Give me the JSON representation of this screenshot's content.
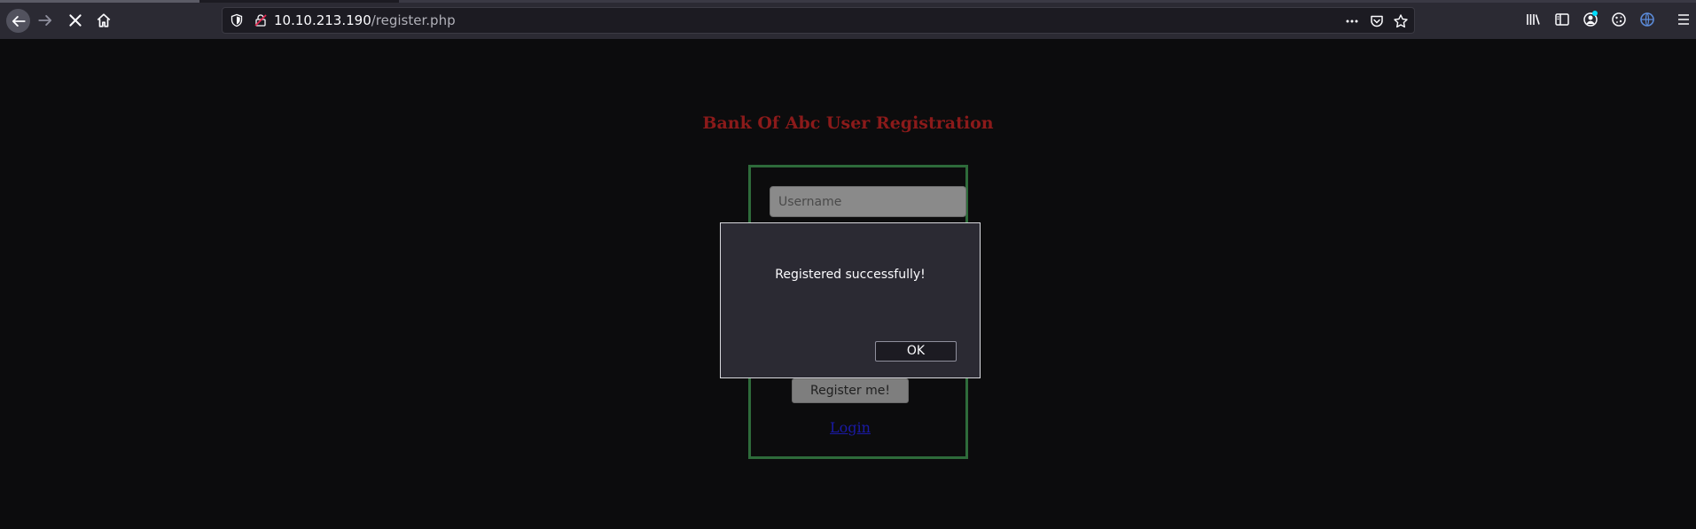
{
  "browser": {
    "url_host": "10.10.213.190",
    "url_path": "/register.php",
    "icons": {
      "back": "back-arrow-icon",
      "forward": "forward-arrow-icon",
      "stop": "stop-loading-icon",
      "home": "home-icon",
      "tracking": "tracking-protection-shield-icon",
      "insecure": "insecure-connection-icon",
      "more": "page-actions-more-icon",
      "pocket": "pocket-icon",
      "bookmark": "bookmark-star-icon",
      "library": "library-icon",
      "sidebar": "sidebar-icon",
      "account": "account-icon",
      "cookie": "cookie-editor-icon",
      "extension": "extension-icon",
      "menu": "hamburger-menu-icon"
    }
  },
  "page": {
    "title": "Bank Of Abc User Registration",
    "username_placeholder": "Username",
    "register_button": "Register me!",
    "login_link": "Login",
    "title_color": "#8b1a1a",
    "border_color": "#2e6b3a"
  },
  "dialog": {
    "message": "Registered successfully!",
    "ok_label": "OK"
  }
}
